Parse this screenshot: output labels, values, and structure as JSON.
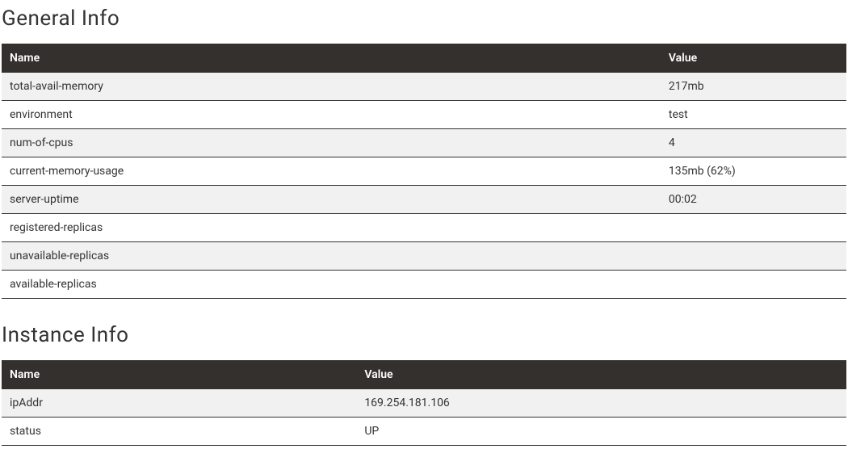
{
  "general": {
    "title": "General Info",
    "headers": {
      "name": "Name",
      "value": "Value"
    },
    "rows": [
      {
        "name": "total-avail-memory",
        "value": "217mb"
      },
      {
        "name": "environment",
        "value": "test"
      },
      {
        "name": "num-of-cpus",
        "value": "4"
      },
      {
        "name": "current-memory-usage",
        "value": "135mb (62%)"
      },
      {
        "name": "server-uptime",
        "value": "00:02"
      },
      {
        "name": "registered-replicas",
        "value": ""
      },
      {
        "name": "unavailable-replicas",
        "value": ""
      },
      {
        "name": "available-replicas",
        "value": ""
      }
    ]
  },
  "instance": {
    "title": "Instance Info",
    "headers": {
      "name": "Name",
      "value": "Value"
    },
    "rows": [
      {
        "name": "ipAddr",
        "value": "169.254.181.106"
      },
      {
        "name": "status",
        "value": "UP"
      }
    ]
  }
}
